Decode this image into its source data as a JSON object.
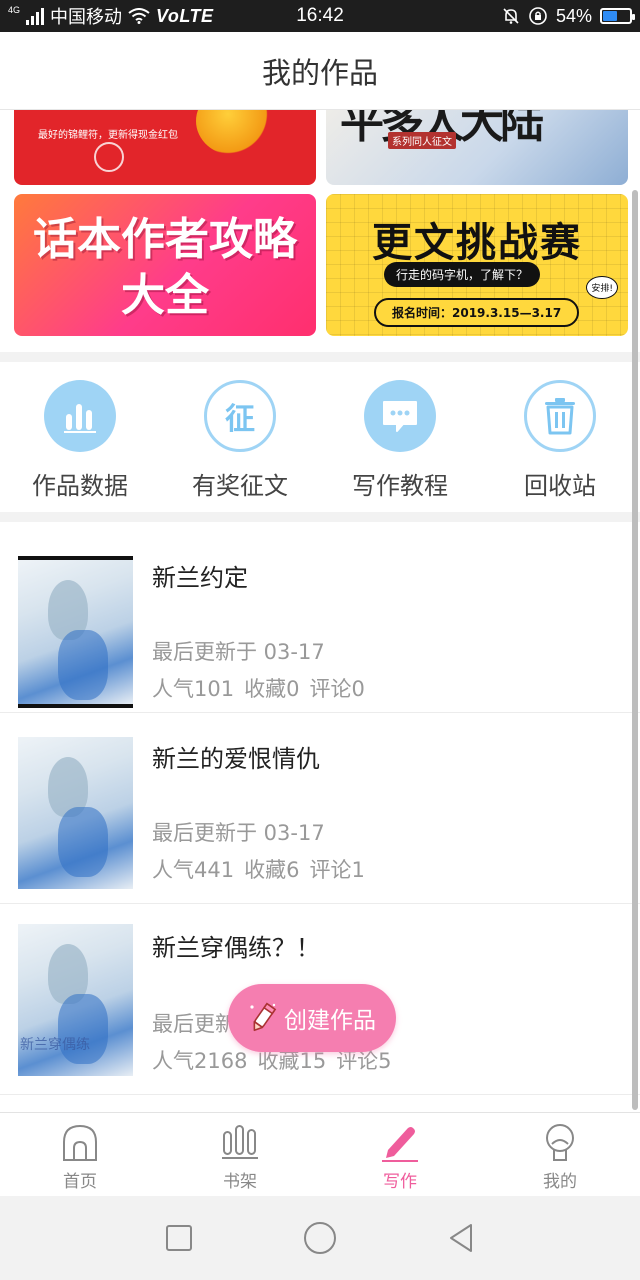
{
  "status_bar": {
    "network_badge": "4G",
    "carrier": "中国移动",
    "volte": "VoLTE",
    "time": "16:42",
    "battery_pct": "54%",
    "battery_level": 0.54
  },
  "header": {
    "title": "我的作品"
  },
  "banners": [
    {
      "caption": "最好的锦鲤符，更新得现金红包"
    },
    {
      "title": "平多人大陆",
      "caption": "系列同人征文"
    },
    {
      "line1": "话本作者攻略",
      "line2": "大全"
    },
    {
      "title": "更文挑战赛",
      "bubble": "行走的码字机，了解下？",
      "date": "报名时间：2019.3.15—3.17",
      "tag": "安排!"
    }
  ],
  "quick_actions": [
    {
      "label": "作品数据",
      "icon": "bar-chart-icon"
    },
    {
      "label": "有奖征文",
      "icon": "contest-icon",
      "glyph": "征"
    },
    {
      "label": "写作教程",
      "icon": "chat-bubble-icon"
    },
    {
      "label": "回收站",
      "icon": "trash-icon"
    }
  ],
  "works": [
    {
      "title": "新兰约定",
      "updated": "最后更新于 03-17",
      "popularity": "人气101",
      "favorites": "收藏0",
      "comments": "评论0",
      "cover_text": ""
    },
    {
      "title": "新兰的爱恨情仇",
      "updated": "最后更新于 03-17",
      "popularity": "人气441",
      "favorites": "收藏6",
      "comments": "评论1",
      "cover_text": ""
    },
    {
      "title": "新兰穿偶练？！",
      "updated": "最后更新于 03-17",
      "popularity": "人气2168",
      "favorites": "收藏15",
      "comments": "评论5",
      "cover_text": "新兰穿偶练"
    }
  ],
  "fab": {
    "label": "创建作品",
    "icon": "pencil-icon"
  },
  "tabs": [
    {
      "label": "首页",
      "icon": "home-icon",
      "active": false
    },
    {
      "label": "书架",
      "icon": "bookshelf-icon",
      "active": false
    },
    {
      "label": "写作",
      "icon": "pen-icon",
      "active": true
    },
    {
      "label": "我的",
      "icon": "profile-icon",
      "active": false
    }
  ],
  "colors": {
    "accent": "#ef5d9c",
    "fab": "#f57eb0",
    "icon_blue": "#9fd4f5"
  }
}
